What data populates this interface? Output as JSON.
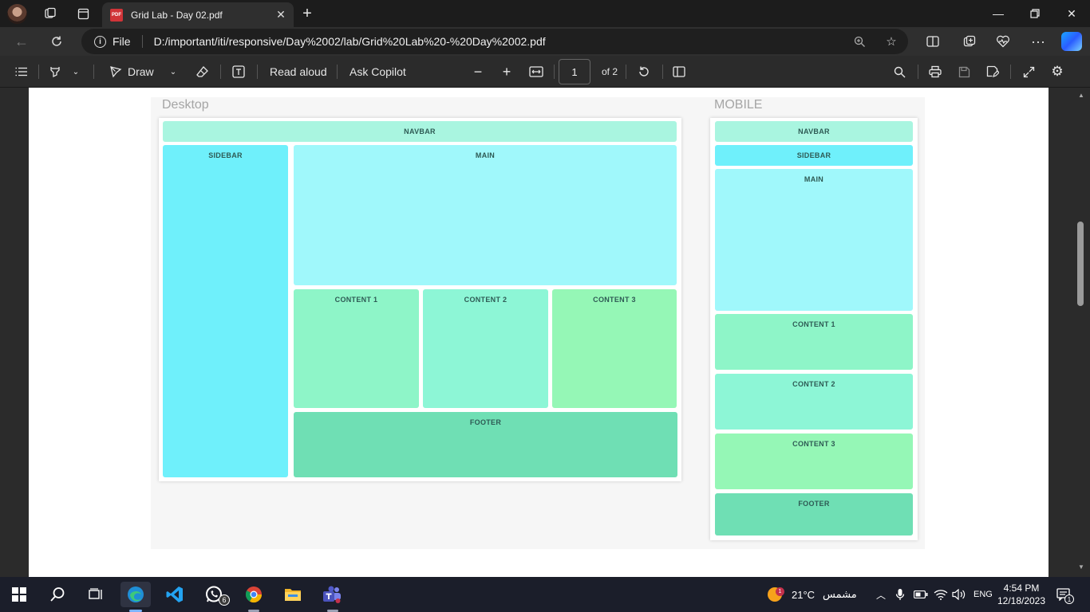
{
  "browser": {
    "tab": {
      "title": "Grid Lab - Day 02.pdf",
      "file_badge": "PDF"
    },
    "address": {
      "scheme_label": "File",
      "url": "D:/important/iti/responsive/Day%2002/lab/Grid%20Lab%20-%20Day%2002.pdf"
    }
  },
  "pdf_toolbar": {
    "draw_label": "Draw",
    "read_aloud_label": "Read aloud",
    "ask_copilot_label": "Ask Copilot",
    "page_current": "1",
    "page_total_label": "of 2"
  },
  "document": {
    "desktop": {
      "title": "Desktop",
      "navbar": "NAVBAR",
      "sidebar": "SIDEBAR",
      "main": "MAIN",
      "content1": "CONTENT 1",
      "content2": "CONTENT 2",
      "content3": "CONTENT 3",
      "footer": "FOOTER"
    },
    "mobile": {
      "title": "MOBILE",
      "navbar": "NAVBAR",
      "sidebar": "SIDEBAR",
      "main": "MAIN",
      "content1": "CONTENT 1",
      "content2": "CONTENT 2",
      "content3": "CONTENT 3",
      "footer": "FOOTER"
    },
    "colors": {
      "navbar": "#a9f5e0",
      "sidebar": "#6ff0fb",
      "main": "#a0f8fb",
      "content1": "#8ef5c8",
      "content2": "#8df6d6",
      "content3": "#95f7b6",
      "footer": "#6fdfb4"
    }
  },
  "taskbar": {
    "whatsapp_badge": "6",
    "weather_badge": "1",
    "temperature": "21°C",
    "weather_text": "مشمس",
    "language": "ENG",
    "time": "4:54 PM",
    "date": "12/18/2023",
    "notifications_count": "1"
  }
}
